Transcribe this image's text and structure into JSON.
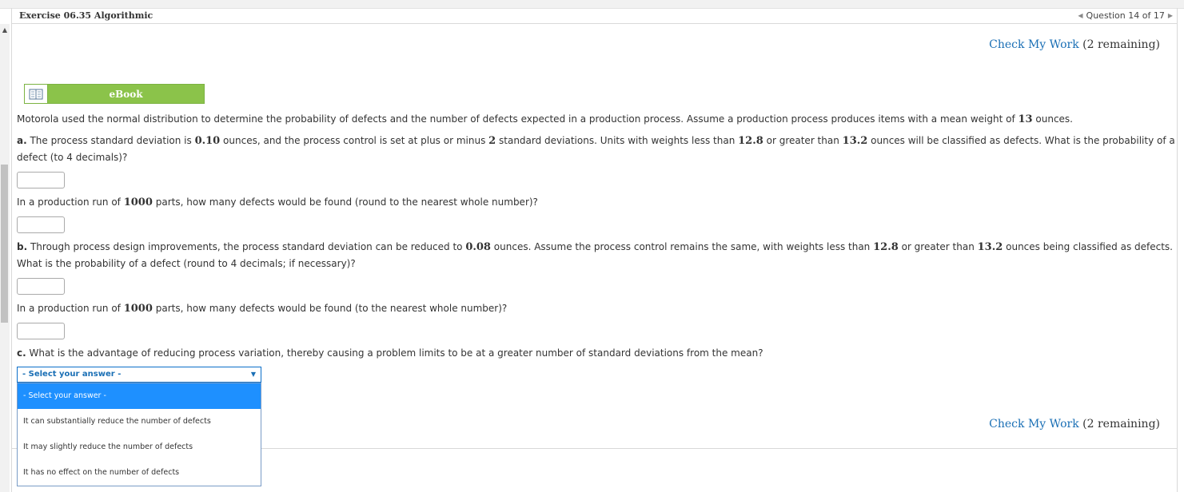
{
  "header": {
    "title": "Exercise 06.35 Algorithmic",
    "question_nav": "Question 14 of 17"
  },
  "check_work": {
    "link": "Check My Work",
    "remaining": "(2 remaining)"
  },
  "ebook": {
    "label": "eBook"
  },
  "intro": {
    "pre": "Motorola used the normal distribution to determine the probability of defects and the number of defects expected in a production process. Assume a production process produces items with a mean weight of ",
    "mean": "13",
    "post": " ounces."
  },
  "part_a": {
    "letter": "a.",
    "t1": " The process standard deviation is ",
    "sd": "0.10",
    "t2": " ounces, and the process control is set at plus or minus ",
    "k": "2",
    "t3": " standard deviations. Units with weights less than ",
    "lower": "12.8",
    "t4": " or greater than ",
    "upper": "13.2",
    "t5": " ounces will be classified as defects. What is the probability of a",
    "line2": "defect (to 4 decimals)?",
    "q2_pre": "In a production run of ",
    "q2_n": "1000",
    "q2_post": " parts, how many defects would be found (round to the nearest whole number)?"
  },
  "part_b": {
    "letter": "b.",
    "t1": " Through process design improvements, the process standard deviation can be reduced to ",
    "sd": "0.08",
    "t2": " ounces. Assume the process control remains the same, with weights less than ",
    "lower": "12.8",
    "t3": " or greater than ",
    "upper": "13.2",
    "t4": " ounces being classified as defects.",
    "line2": "What is the probability of a defect (round to 4 decimals; if necessary)?",
    "q2_pre": "In a production run of ",
    "q2_n": "1000",
    "q2_post": " parts, how many defects would be found (to the nearest whole number)?"
  },
  "part_c": {
    "letter": "c.",
    "text": " What is the advantage of reducing process variation, thereby causing a problem limits to be at a greater number of standard deviations from the mean?",
    "selected": "- Select your answer -",
    "options": [
      "- Select your answer -",
      "It can substantially reduce the number of defects",
      "It may slightly reduce the number of defects",
      "It has no effect on the number of defects"
    ]
  },
  "colors": {
    "link": "#1a6fb5",
    "ebook_green": "#8bc34a",
    "option_highlight": "#1e90ff"
  }
}
